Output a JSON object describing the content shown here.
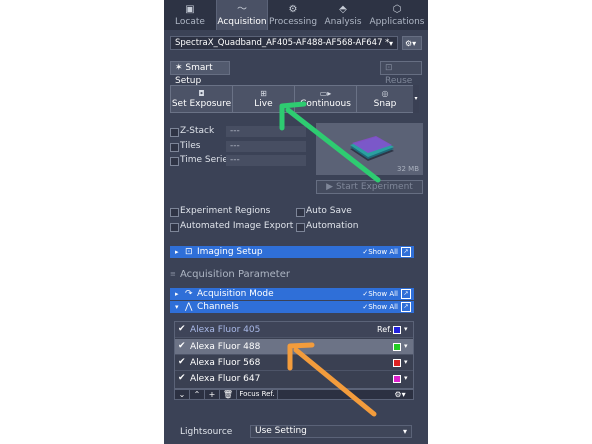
{
  "tabs": [
    {
      "label": "Locate",
      "icon": "▣",
      "active": false
    },
    {
      "label": "Acquisition",
      "icon": "〜",
      "active": true
    },
    {
      "label": "Processing",
      "icon": "⚙",
      "active": false
    },
    {
      "label": "Analysis",
      "icon": "⬘",
      "active": false
    },
    {
      "label": "Applications",
      "icon": "⬡",
      "active": false
    }
  ],
  "experiment": {
    "name": "SpectraX_Quadband_AF405-AF488-AF568-AF647 *",
    "caret": "▾",
    "gear": "⚙▾"
  },
  "smart_setup": {
    "label": "Smart Setup",
    "icon": "✶"
  },
  "reuse": {
    "label": "Reuse",
    "icon": "⊡"
  },
  "exposure_buttons": [
    {
      "label": "Set Exposure",
      "icon": "◘"
    },
    {
      "label": "Live",
      "icon": "⊞"
    },
    {
      "label": "Continuous",
      "icon": "▭▸"
    },
    {
      "label": "Snap",
      "icon": "◎"
    }
  ],
  "options": [
    {
      "label": "Z-Stack",
      "value": "---"
    },
    {
      "label": "Tiles",
      "value": "---"
    },
    {
      "label": "Time Series",
      "value": "---"
    }
  ],
  "preview": {
    "size": "32 MB"
  },
  "start_experiment": {
    "label": "Start Experiment",
    "icon": "▶"
  },
  "checks": {
    "experiment_regions": "Experiment Regions",
    "auto_save": "Auto Save",
    "automated_export": "Automated Image Export",
    "automation": "Automation"
  },
  "imaging_setup": {
    "title": "Imaging Setup",
    "show_all": "✓Show All"
  },
  "acq_param": {
    "title": "Acquisition Parameter",
    "handle": "≡"
  },
  "acq_mode": {
    "title": "Acquisition Mode",
    "show_all": "✓Show All"
  },
  "channels": {
    "title": "Channels",
    "show_all": "✓Show All",
    "rows": [
      {
        "name": "Alexa Fluor 405",
        "ref": "Ref.",
        "color": "#2222dd",
        "checked": "✔"
      },
      {
        "name": "Alexa Fluor 488",
        "ref": "",
        "color": "#22cc22",
        "checked": "✔"
      },
      {
        "name": "Alexa Fluor 568",
        "ref": "",
        "color": "#dd2222",
        "checked": "✔"
      },
      {
        "name": "Alexa Fluor 647",
        "ref": "",
        "color": "#dd22cc",
        "checked": "✔"
      }
    ]
  },
  "channel_toolbar": {
    "down": "⌄",
    "up": "⌃",
    "add": "+",
    "delete": "🗑",
    "focus_ref": "Focus Ref.",
    "settings": "⚙▾"
  },
  "lightsource": {
    "label": "Lightsource",
    "value": "Use Setting"
  },
  "colors": {
    "green_arrow": "#2ecc71",
    "orange_arrow": "#f39c3c",
    "section_blue": "#2f6fd8"
  }
}
